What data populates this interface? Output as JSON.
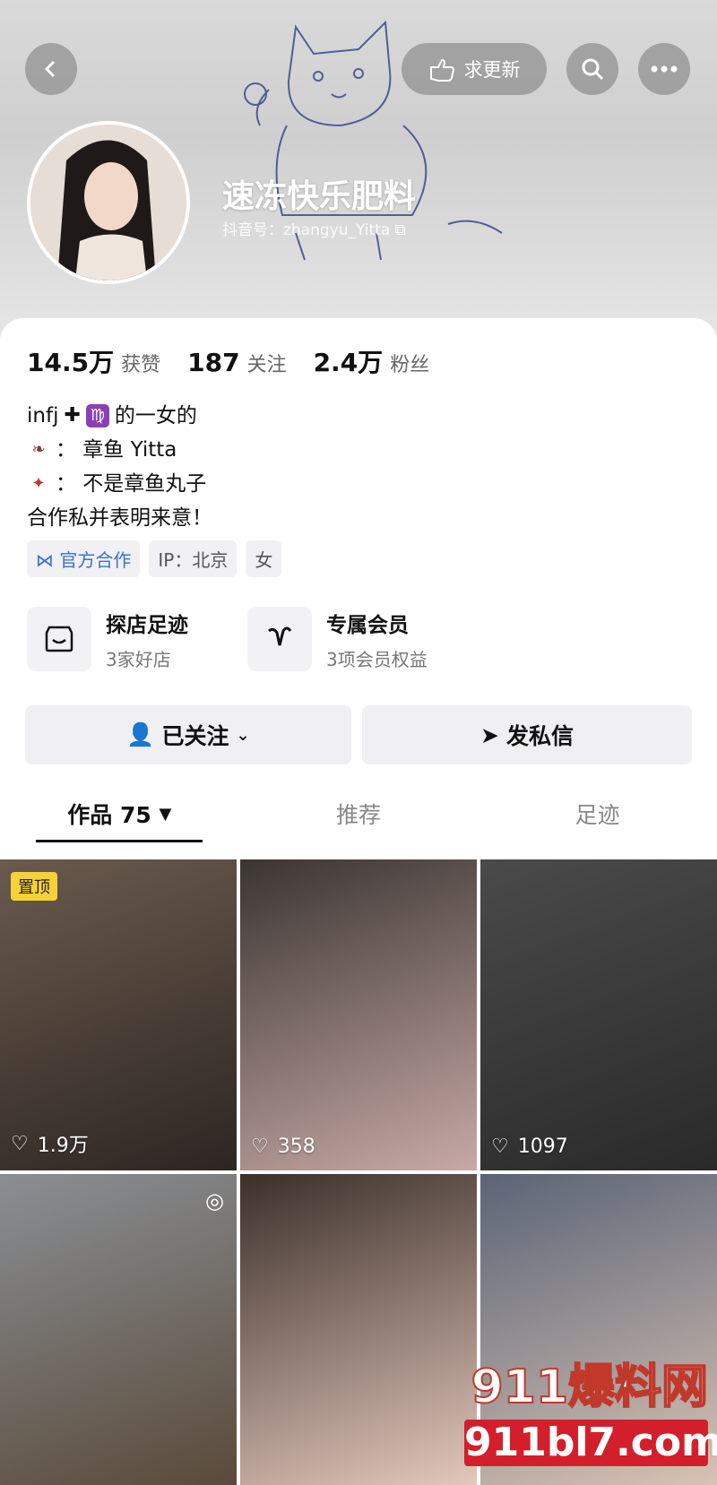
{
  "header": {
    "back_icon": "chevron-left-icon",
    "request_update_label": "求更新",
    "search_icon": "search-icon",
    "more_icon": "more-icon",
    "name": "速冻快乐肥料",
    "uid": "抖音号：zhangyu_Yitta"
  },
  "stats": [
    {
      "value": "14.5万",
      "label": "获赞"
    },
    {
      "value": "187",
      "label": "关注"
    },
    {
      "value": "2.4万",
      "label": "粉丝"
    }
  ],
  "bio": {
    "line1_pre": "infj",
    "line1_post": "的一女的",
    "line2": "：  章鱼 Yitta",
    "line3": "：  不是章鱼丸子",
    "line4": "合作私并表明来意！"
  },
  "tags": [
    "官方合作",
    "IP：北京",
    "女"
  ],
  "features": [
    {
      "title": "探店足迹",
      "sub": "3家好店"
    },
    {
      "title": "专属会员",
      "sub": "3项会员权益"
    }
  ],
  "actions": {
    "follow": "已关注",
    "message": "发私信"
  },
  "tabs": [
    "作品 75",
    "推荐",
    "足迹"
  ],
  "grid": [
    {
      "likes": "1.9万",
      "pinned": "置顶"
    },
    {
      "likes": "358"
    },
    {
      "likes": "1097"
    },
    {
      "likes": ""
    },
    {
      "likes": ""
    },
    {
      "likes": ""
    }
  ],
  "watermark": {
    "line1": "911爆料网",
    "line2": "911bl7.com"
  }
}
